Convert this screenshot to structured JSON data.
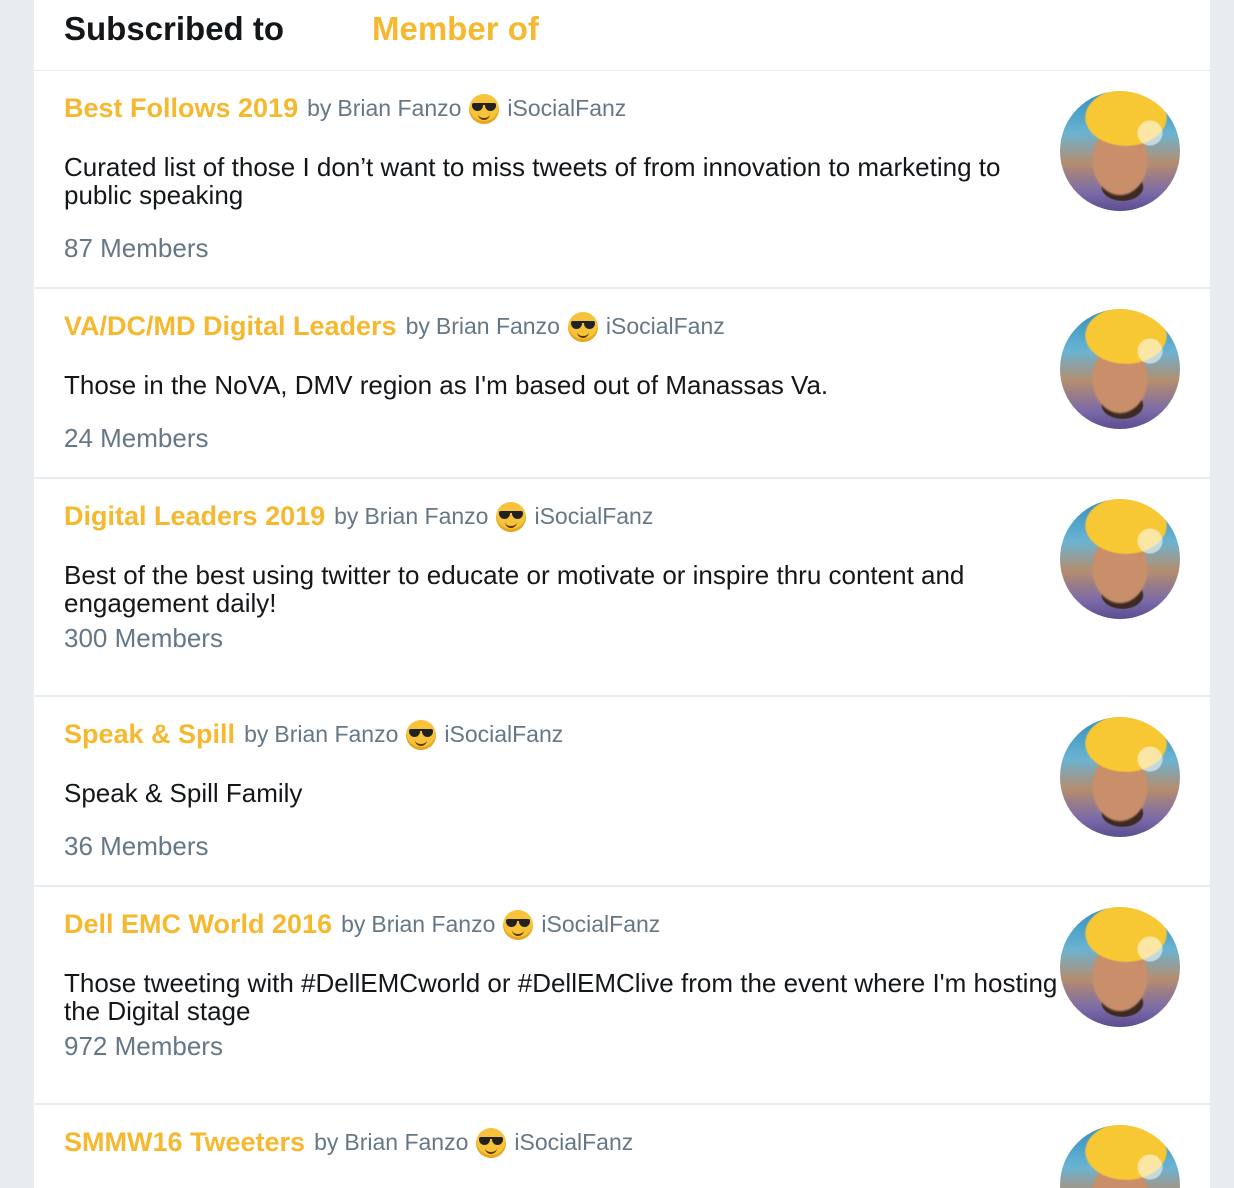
{
  "tabs": {
    "subscribed": "Subscribed to",
    "member": "Member of"
  },
  "lists": [
    {
      "name": "Best Follows 2019",
      "by": "by",
      "owner": "Brian Fanzo",
      "handle": "iSocialFanz",
      "description": "Curated list of those I don’t want to miss tweets of from innovation to marketing to public speaking",
      "members": "87 Members"
    },
    {
      "name": "VA/DC/MD Digital Leaders",
      "by": "by",
      "owner": "Brian Fanzo",
      "handle": "iSocialFanz",
      "description": "Those in the NoVA, DMV region as I'm based out of Manassas Va.",
      "members": "24 Members"
    },
    {
      "name": "Digital Leaders 2019",
      "by": "by",
      "owner": "Brian Fanzo",
      "handle": "iSocialFanz",
      "description": "Best of the best using twitter to educate or motivate or inspire thru content and engagement daily!",
      "members": "300 Members"
    },
    {
      "name": "Speak & Spill",
      "by": "by",
      "owner": "Brian Fanzo",
      "handle": "iSocialFanz",
      "description": "Speak & Spill Family",
      "members": "36 Members"
    },
    {
      "name": "Dell EMC World 2016",
      "by": "by",
      "owner": "Brian Fanzo",
      "handle": "iSocialFanz",
      "description": "Those tweeting with #DellEMCworld or #DellEMClive from the event where I'm hosting the Digital stage",
      "members": "972 Members"
    },
    {
      "name": "SMMW16 Tweeters",
      "by": "by",
      "owner": "Brian Fanzo",
      "handle": "iSocialFanz",
      "description": "",
      "members": ""
    }
  ],
  "icons": {
    "emoji": "smiling-face-with-sunglasses-icon",
    "avatar": "avatar"
  },
  "colors": {
    "accent": "#f5b82e",
    "text": "#14171a",
    "muted": "#657786",
    "divider": "#e6ecf0",
    "background": "#e6ecf0"
  }
}
